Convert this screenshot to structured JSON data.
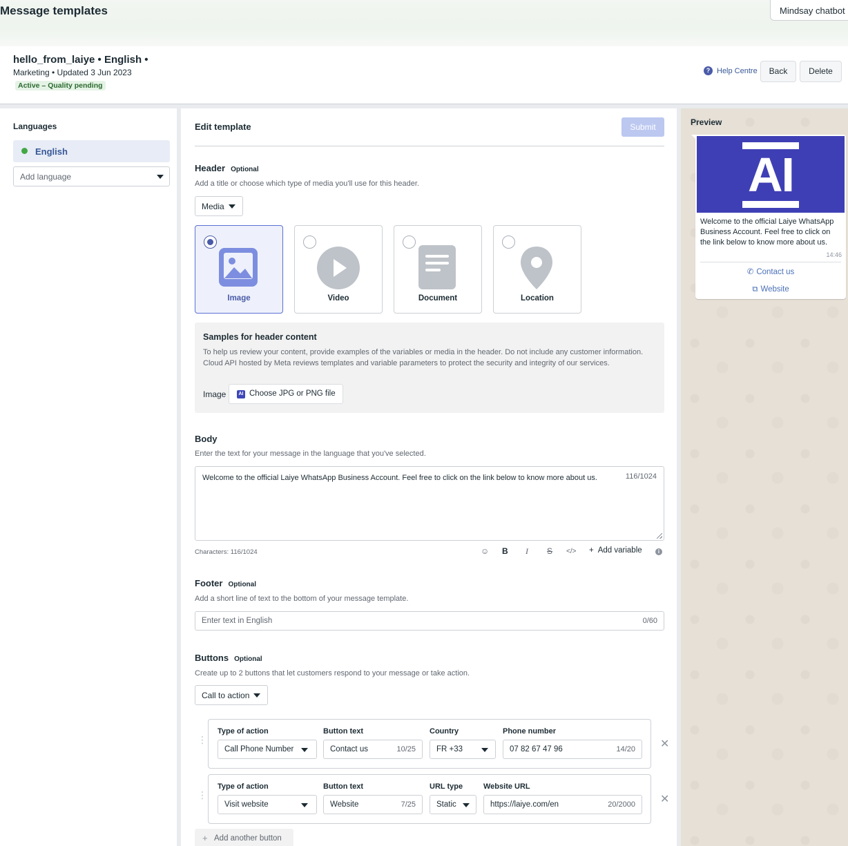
{
  "top": {
    "title": "Message templates",
    "account": "Mindsay chatbot"
  },
  "template": {
    "name": "hello_from_laiye • English •",
    "meta": "Marketing • Updated 3 Jun 2023",
    "status": "Active – Quality pending",
    "help": "Help Centre",
    "back": "Back",
    "delete": "Delete"
  },
  "languages": {
    "title": "Languages",
    "selected": "English",
    "add_placeholder": "Add language"
  },
  "editor": {
    "title": "Edit template",
    "submit": "Submit",
    "header": {
      "title": "Header",
      "optional": "Optional",
      "desc": "Add a title or choose which type of media you'll use for this header.",
      "type": "Media",
      "media_options": [
        "Image",
        "Video",
        "Document",
        "Location"
      ],
      "selected": "Image"
    },
    "samples": {
      "title": "Samples for header content",
      "desc": "To help us review your content, provide examples of the variables or media in the header. Do not include any customer information. Cloud API hosted by Meta reviews templates and variable parameters to protect the security and integrity of our services.",
      "image_label": "Image",
      "file_button": "Choose JPG or PNG file"
    },
    "body": {
      "title": "Body",
      "desc": "Enter the text for your message in the language that you've selected.",
      "text": "Welcome to the official Laiye WhatsApp Business Account. Feel free to click on the link below to know more about us.",
      "count": "116/1024",
      "characters": "Characters: 116/1024",
      "add_variable": "Add variable"
    },
    "footer": {
      "title": "Footer",
      "optional": "Optional",
      "desc": "Add a short line of text to the bottom of your message template.",
      "placeholder": "Enter text in English",
      "count": "0/60"
    },
    "buttons": {
      "title": "Buttons",
      "optional": "Optional",
      "desc": "Create up to 2 buttons that let customers respond to your message or take action.",
      "type": "Call to action",
      "call": {
        "type_label": "Type of action",
        "type_value": "Call Phone Number",
        "text_label": "Button text",
        "text_value": "Contact us",
        "text_count": "10/25",
        "country_label": "Country",
        "country_value": "FR +33",
        "phone_label": "Phone number",
        "phone_value": "07 82 67 47 96",
        "phone_count": "14/20"
      },
      "web": {
        "type_label": "Type of action",
        "type_value": "Visit website",
        "text_label": "Button text",
        "text_value": "Website",
        "text_count": "7/25",
        "url_type_label": "URL type",
        "url_type_value": "Static",
        "url_label": "Website URL",
        "url_value": "https://laiye.com/en",
        "url_count": "20/2000"
      },
      "add_another": "Add another button"
    }
  },
  "preview": {
    "title": "Preview",
    "image_text": "AI",
    "message": "Welcome to the official Laiye WhatsApp Business Account. Feel free to click on the link below to know more about us.",
    "time": "14:46",
    "call_button": "Contact us",
    "web_button": "Website"
  },
  "colors": {
    "accent": "#4a5ba8",
    "status_green": "#42a744",
    "preview_image": "#3f3fb5"
  }
}
